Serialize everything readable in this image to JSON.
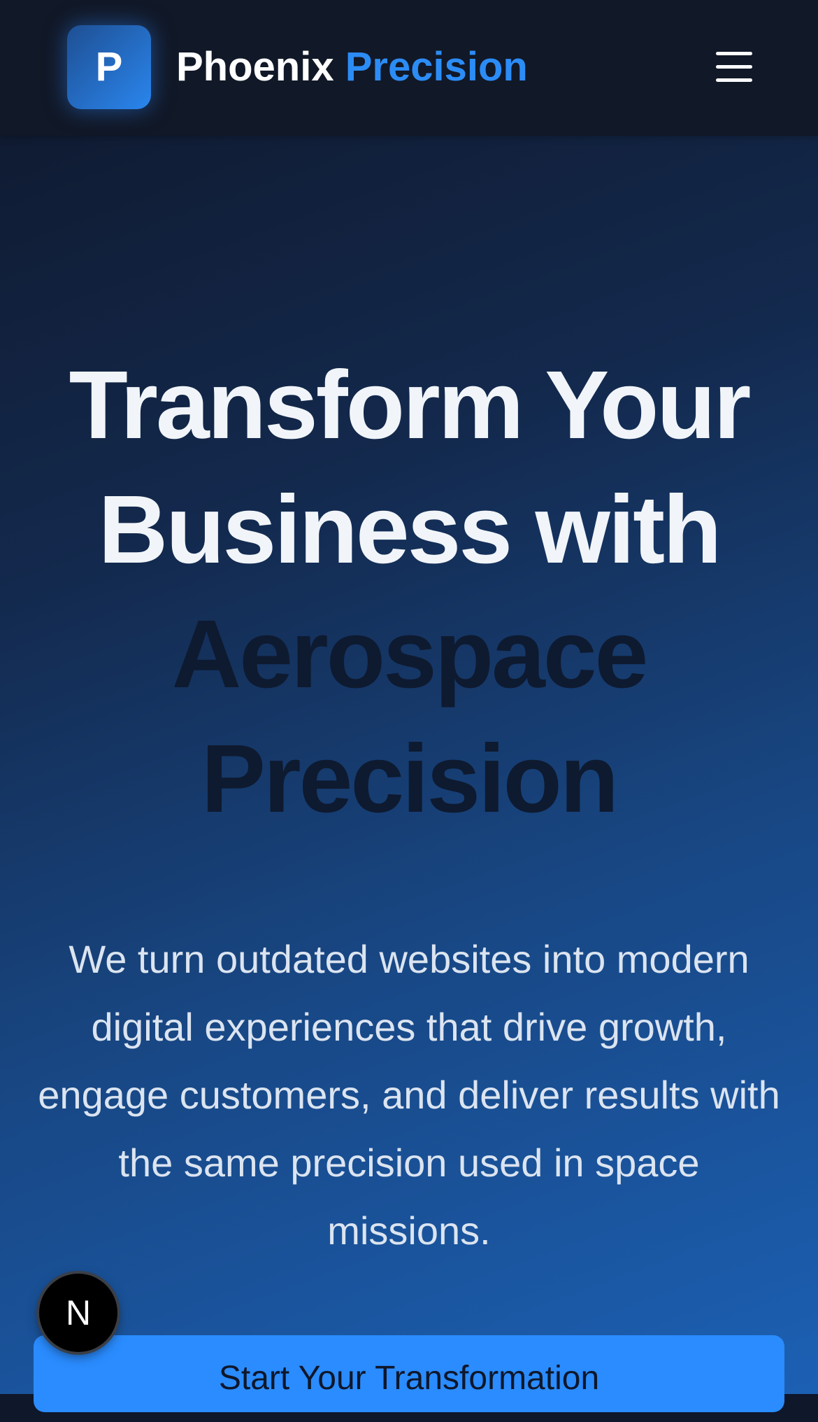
{
  "header": {
    "logo_letter": "P",
    "brand_primary": "Phoenix",
    "brand_accent": "Precision",
    "menu_icon": "hamburger-menu-icon"
  },
  "hero": {
    "headline_line1": "Transform Your",
    "headline_line2": "Business with",
    "headline_line3": "Aerospace",
    "headline_line4": "Precision",
    "description": "We turn outdated websites into modern digital experiences that drive growth, engage customers, and deliver results with the same precision used in space missions.",
    "cta_label": "Start Your Transformation"
  },
  "dev_badge": {
    "letter": "N"
  },
  "colors": {
    "nav_bg": "#111827",
    "accent": "#2c8cf6",
    "cta_bg": "#2a8cff",
    "headline_light": "#f1f5f9",
    "headline_dark": "#0e1a30"
  }
}
